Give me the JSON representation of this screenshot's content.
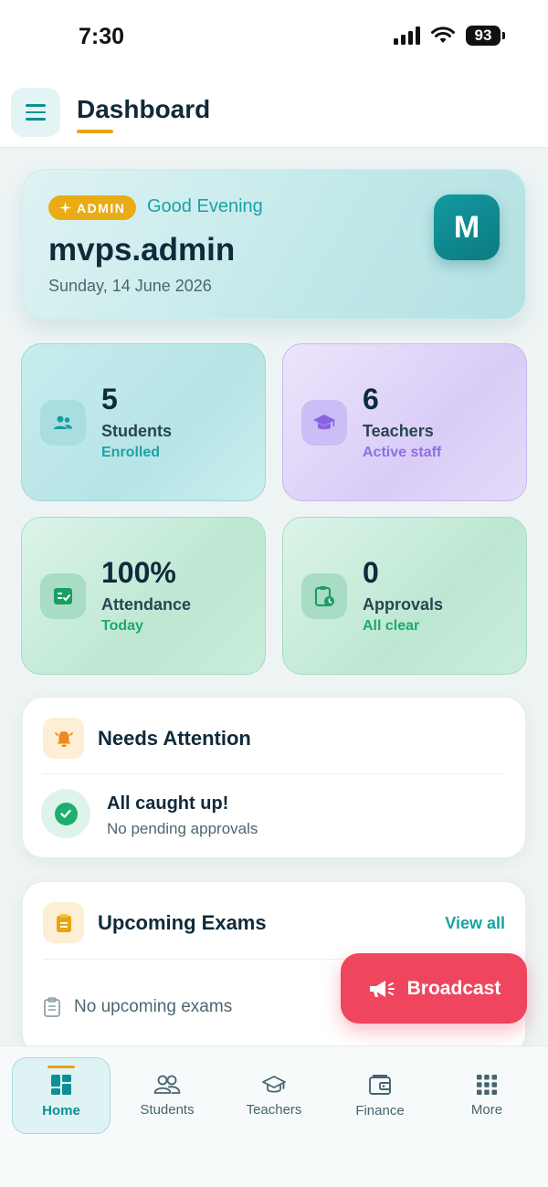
{
  "status_bar": {
    "time": "7:30",
    "battery": "93"
  },
  "header": {
    "title": "Dashboard",
    "menu_icon": "hamburger-menu-icon"
  },
  "greeting": {
    "badge": "ADMIN",
    "greeting": "Good Evening",
    "username": "mvps.admin",
    "date": "Sunday, 14 June 2026",
    "avatar_letter": "M"
  },
  "stats": [
    {
      "value": "5",
      "label": "Students",
      "sub": "Enrolled",
      "icon": "users-icon",
      "color": "#1ea2a6"
    },
    {
      "value": "6",
      "label": "Teachers",
      "sub": "Active staff",
      "icon": "graduation-cap-icon",
      "color": "#8d6ee3"
    },
    {
      "value": "100%",
      "label": "Attendance",
      "sub": "Today",
      "icon": "checklist-icon",
      "color": "#1eaa6a"
    },
    {
      "value": "0",
      "label": "Approvals",
      "sub": "All clear",
      "icon": "clipboard-clock-icon",
      "color": "#1eaa6a"
    }
  ],
  "attention": {
    "title": "Needs Attention",
    "status_title": "All caught up!",
    "status_sub": "No pending approvals"
  },
  "exams": {
    "title": "Upcoming Exams",
    "view_all": "View all",
    "empty": "No upcoming exams"
  },
  "broadcast": {
    "label": "Broadcast",
    "color": "#f0455e"
  },
  "nav": [
    {
      "label": "Home",
      "icon": "home-grid-icon",
      "active": true
    },
    {
      "label": "Students",
      "icon": "users-icon",
      "active": false
    },
    {
      "label": "Teachers",
      "icon": "graduation-cap-icon",
      "active": false
    },
    {
      "label": "Finance",
      "icon": "wallet-icon",
      "active": false
    },
    {
      "label": "More",
      "icon": "apps-grid-icon",
      "active": false
    }
  ],
  "colors": {
    "accent": "#0d8f96",
    "highlight": "#e8a317"
  }
}
